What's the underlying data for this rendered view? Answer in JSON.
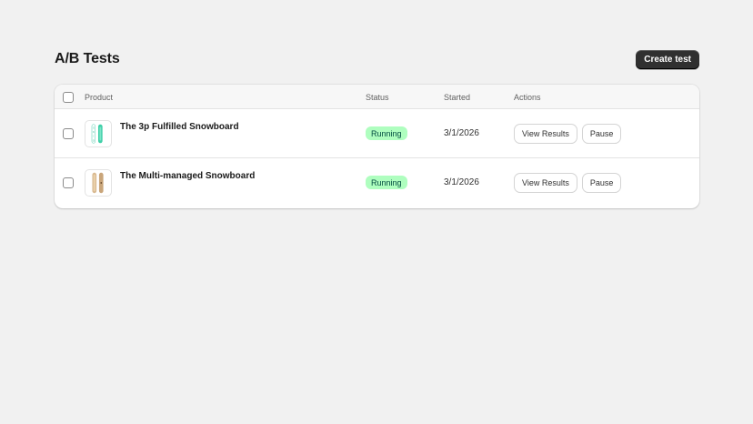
{
  "page": {
    "title": "A/B Tests",
    "create_button_label": "Create test"
  },
  "table": {
    "columns": {
      "product": "Product",
      "status": "Status",
      "started": "Started",
      "actions": "Actions"
    },
    "rows": [
      {
        "product": "The 3p Fulfilled Snowboard",
        "thumbnail_icon": "snowboard-teal-icon",
        "status": "Running",
        "started": "3/1/2026",
        "view_label": "View Results",
        "pause_label": "Pause"
      },
      {
        "product": "The Multi-managed Snowboard",
        "thumbnail_icon": "snowboard-wood-icon",
        "status": "Running",
        "started": "3/1/2026",
        "view_label": "View Results",
        "pause_label": "Pause"
      }
    ]
  },
  "colors": {
    "background": "#f1f1f1",
    "primary_button": "#303030",
    "badge_success_bg": "#affebf",
    "badge_success_text": "#014b40"
  }
}
